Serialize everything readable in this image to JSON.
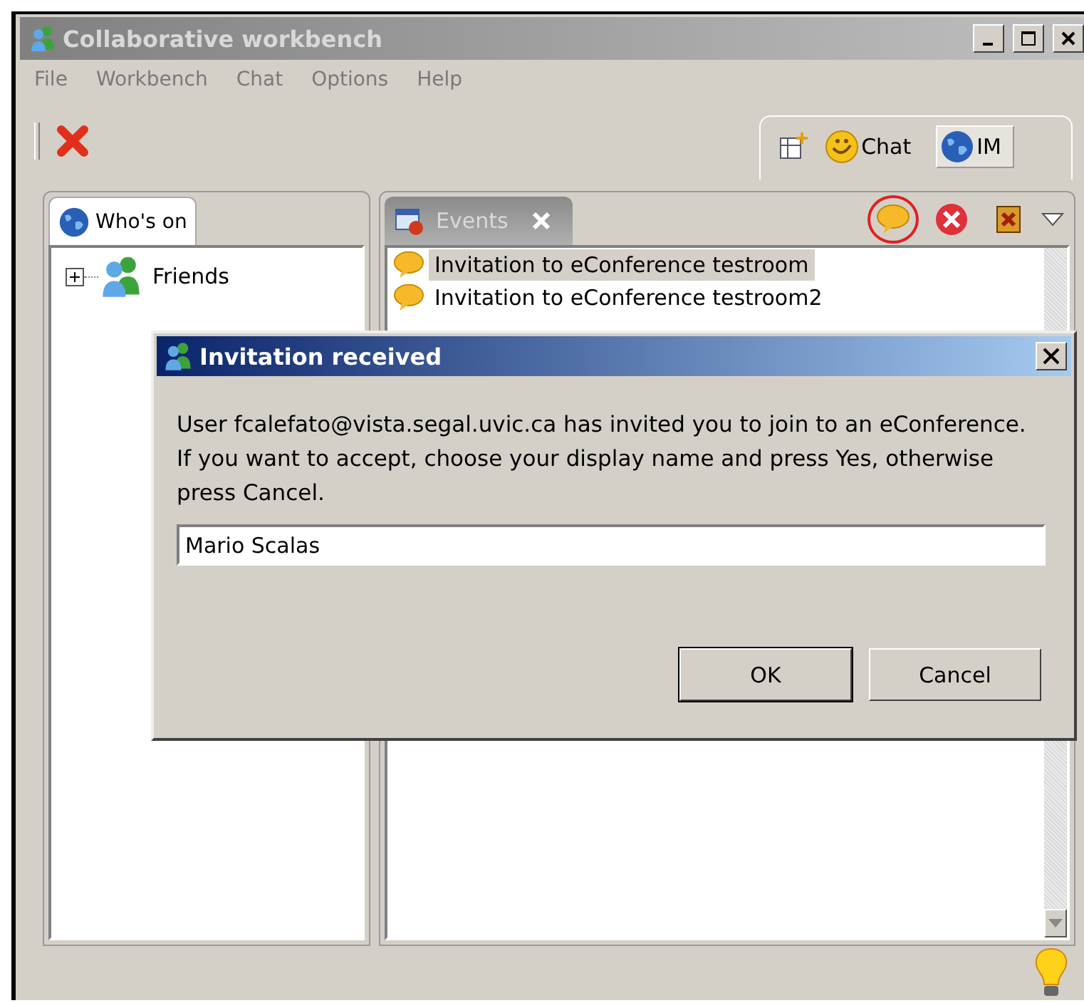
{
  "window": {
    "title": "Collaborative workbench"
  },
  "menu": [
    "File",
    "Workbench",
    "Chat",
    "Options",
    "Help"
  ],
  "perspectives": [
    {
      "kind": "chat",
      "label": "Chat",
      "selected": false
    },
    {
      "kind": "im",
      "label": "IM",
      "selected": true
    }
  ],
  "whos_on": {
    "tab": "Who's on",
    "tree": [
      {
        "label": "Friends",
        "expanded": false
      }
    ]
  },
  "events": {
    "tab": "Events",
    "actions": [
      {
        "kind": "accept",
        "highlighted": true
      },
      {
        "kind": "remove",
        "highlighted": false
      },
      {
        "kind": "clear",
        "highlighted": false
      }
    ],
    "items": [
      {
        "label": "Invitation to eConference testroom",
        "selected": true
      },
      {
        "label": "Invitation to eConference testroom2",
        "selected": false
      }
    ]
  },
  "dialog": {
    "title": "Invitation received",
    "message": "User fcalefato@vista.segal.uvic.ca has invited you to join to an eConference. If you want to accept, choose your display name and press Yes, otherwise press Cancel.",
    "value": "Mario Scalas",
    "buttons": [
      "OK",
      "Cancel"
    ]
  }
}
